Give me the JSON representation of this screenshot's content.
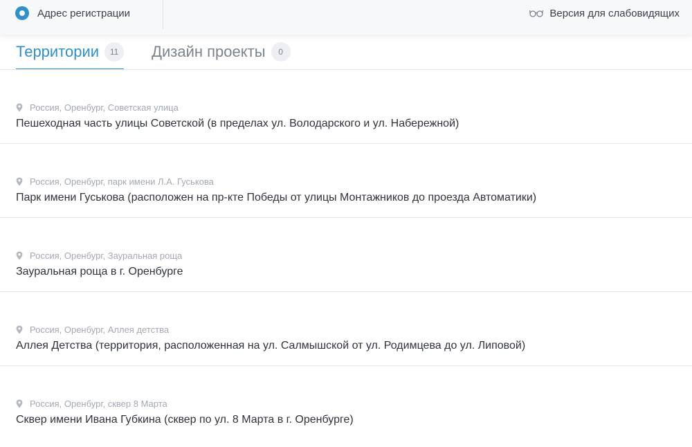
{
  "topbar": {
    "registration_label": "Адрес регистрации",
    "accessibility_label": "Версия для слабовидящих"
  },
  "tabs": [
    {
      "label": "Территории",
      "count": "11",
      "active": true
    },
    {
      "label": "Дизайн проекты",
      "count": "0",
      "active": false
    }
  ],
  "items": [
    {
      "location": "Россия, Оренбург, Советская улица",
      "title": "Пешеходная часть улицы Советской (в пределах ул. Володарского и ул. Набережной)"
    },
    {
      "location": "Россия, Оренбург, парк имени Л.А. Гуськова",
      "title": "Парк имени Гуськова (расположен на пр-кте Победы от улицы Монтажников до проезда Автоматики)"
    },
    {
      "location": "Россия, Оренбург, Зауральная роща",
      "title": "Зауральная роща в г. Оренбурге"
    },
    {
      "location": "Россия, Оренбург, Аллея детства",
      "title": "Аллея Детства (территория, расположенная на ул. Салмышской от ул. Родимцева до ул. Липовой)"
    },
    {
      "location": "Россия, Оренбург, сквер 8 Марта",
      "title": "Сквер имени Ивана Губкина (сквер по ул. 8 Марта в г. Оренбурге)"
    }
  ],
  "colors": {
    "accent": "#2f8fcf",
    "muted_text": "#a3a9b1",
    "divider": "#e6e8eb"
  },
  "icons": {
    "registration": "radio-icon",
    "accessibility": "glasses-icon",
    "location": "map-pin-icon"
  }
}
